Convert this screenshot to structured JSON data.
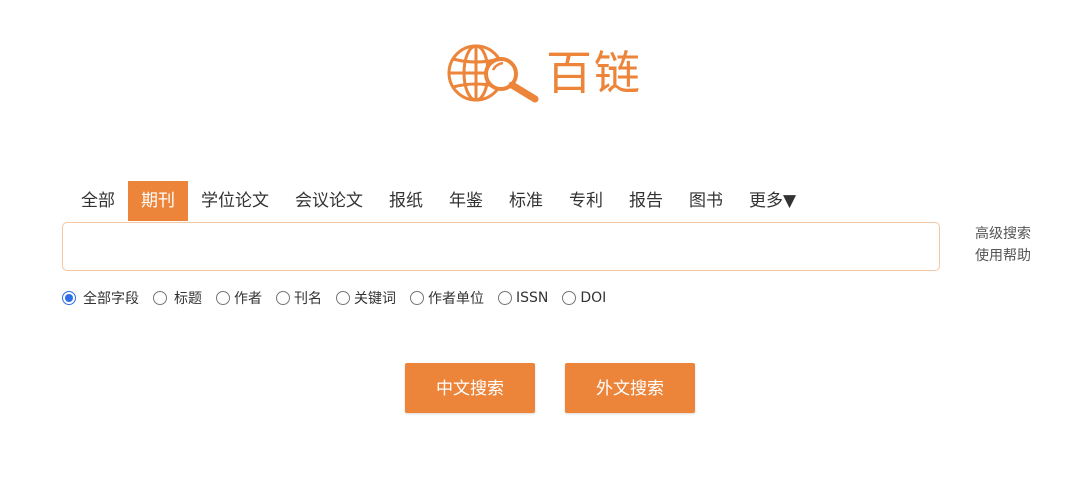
{
  "brand": {
    "name": "百链",
    "logo_icon": "globe-magnifier-icon",
    "color": "#ec8439"
  },
  "tabs": [
    {
      "label": "全部",
      "active": false
    },
    {
      "label": "期刊",
      "active": true
    },
    {
      "label": "学位论文",
      "active": false
    },
    {
      "label": "会议论文",
      "active": false
    },
    {
      "label": "报纸",
      "active": false
    },
    {
      "label": "年鉴",
      "active": false
    },
    {
      "label": "标准",
      "active": false
    },
    {
      "label": "专利",
      "active": false
    },
    {
      "label": "报告",
      "active": false
    },
    {
      "label": "图书",
      "active": false
    },
    {
      "label": "更多▼",
      "active": false
    }
  ],
  "search": {
    "value": "",
    "placeholder": ""
  },
  "side_links": {
    "advanced": "高级搜索",
    "help": "使用帮助"
  },
  "filters": [
    {
      "label": "全部字段",
      "checked": true
    },
    {
      "label": "标题",
      "checked": false
    },
    {
      "label": "作者",
      "checked": false
    },
    {
      "label": "刊名",
      "checked": false
    },
    {
      "label": "关键词",
      "checked": false
    },
    {
      "label": "作者单位",
      "checked": false
    },
    {
      "label": "ISSN",
      "checked": false
    },
    {
      "label": "DOI",
      "checked": false
    }
  ],
  "buttons": {
    "chinese_search": "中文搜索",
    "foreign_search": "外文搜索"
  },
  "colors": {
    "accent": "#ec8439",
    "radio_selected": "#2e6ee6",
    "input_border": "#f3c7a4"
  }
}
